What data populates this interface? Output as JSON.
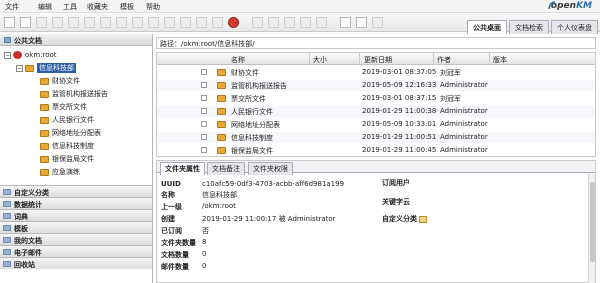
{
  "menu": [
    "文件",
    "编辑",
    "工具",
    "收藏夹",
    "模板",
    "帮助"
  ],
  "logo": {
    "part1": "open",
    "part2": "KM"
  },
  "top_tabs": [
    {
      "label": "公共桌面",
      "active": true
    },
    {
      "label": "文档检索",
      "active": false
    },
    {
      "label": "个人仪表盘",
      "active": false
    }
  ],
  "left": {
    "header": "公共文档",
    "tree": [
      {
        "label": "okm:root",
        "level": 0,
        "type": "root",
        "expanded": true
      },
      {
        "label": "信息科技部",
        "level": 1,
        "type": "folder",
        "expanded": true,
        "selected": true
      },
      {
        "label": "财协文件",
        "level": 2,
        "type": "folder"
      },
      {
        "label": "监管机构报送报告",
        "level": 2,
        "type": "folder"
      },
      {
        "label": "票交所文件",
        "level": 2,
        "type": "folder"
      },
      {
        "label": "人民银行文件",
        "level": 2,
        "type": "folder"
      },
      {
        "label": "网络地址分配表",
        "level": 2,
        "type": "folder"
      },
      {
        "label": "信息科技制度",
        "level": 2,
        "type": "folder"
      },
      {
        "label": "银保监局文件",
        "level": 2,
        "type": "folder"
      },
      {
        "label": "应急演练",
        "level": 2,
        "type": "folder"
      }
    ],
    "stack": [
      "自定义分类",
      "数据统计",
      "词典",
      "模板",
      "我的文档",
      "电子邮件",
      "回收站"
    ]
  },
  "path": "路径：/okm:root/信息科技部/",
  "grid": {
    "columns": [
      "名称",
      "大小",
      "更新日期",
      "作者",
      "版本"
    ],
    "rows": [
      {
        "name": "财协文件",
        "date": "2019-03-01 08:37:05",
        "author": "刘冠军"
      },
      {
        "name": "监管机构报送报告",
        "date": "2019-05-09 12:16:33",
        "author": "Administrator"
      },
      {
        "name": "票交所文件",
        "date": "2019-03-01 08:37:15",
        "author": "刘冠军"
      },
      {
        "name": "人民银行文件",
        "date": "2019-01-29 11:00:38",
        "author": "Administrator"
      },
      {
        "name": "网络地址分配表",
        "date": "2019-05-09 10:33:01",
        "author": "Administrator"
      },
      {
        "name": "信息科技制度",
        "date": "2019-01-29 11:00:51",
        "author": "Administrator"
      },
      {
        "name": "银保监局文件",
        "date": "2019-01-29 11:00:45",
        "author": "Administrator"
      }
    ]
  },
  "props": {
    "tabs": [
      {
        "label": "文件夹属性",
        "active": true
      },
      {
        "label": "文档备注",
        "active": false
      },
      {
        "label": "文件夹权限",
        "active": false
      }
    ],
    "fields": [
      {
        "k": "UUID",
        "v": "c10afc59-0df3-4703-acbb-aff6d981a199"
      },
      {
        "k": "名称",
        "v": "信息科技部"
      },
      {
        "k": "上一级",
        "v": "/okm:root"
      },
      {
        "k": "创建",
        "v": "2019-01-29 11:00:17 被 Administrator"
      },
      {
        "k": "已订阅",
        "v": "否"
      },
      {
        "k": "文件夹数量",
        "v": "8"
      },
      {
        "k": "文档数量",
        "v": "0"
      },
      {
        "k": "邮件数量",
        "v": "0"
      }
    ],
    "right_labels": [
      "订阅用户",
      "关键字云",
      "自定义分类"
    ]
  }
}
